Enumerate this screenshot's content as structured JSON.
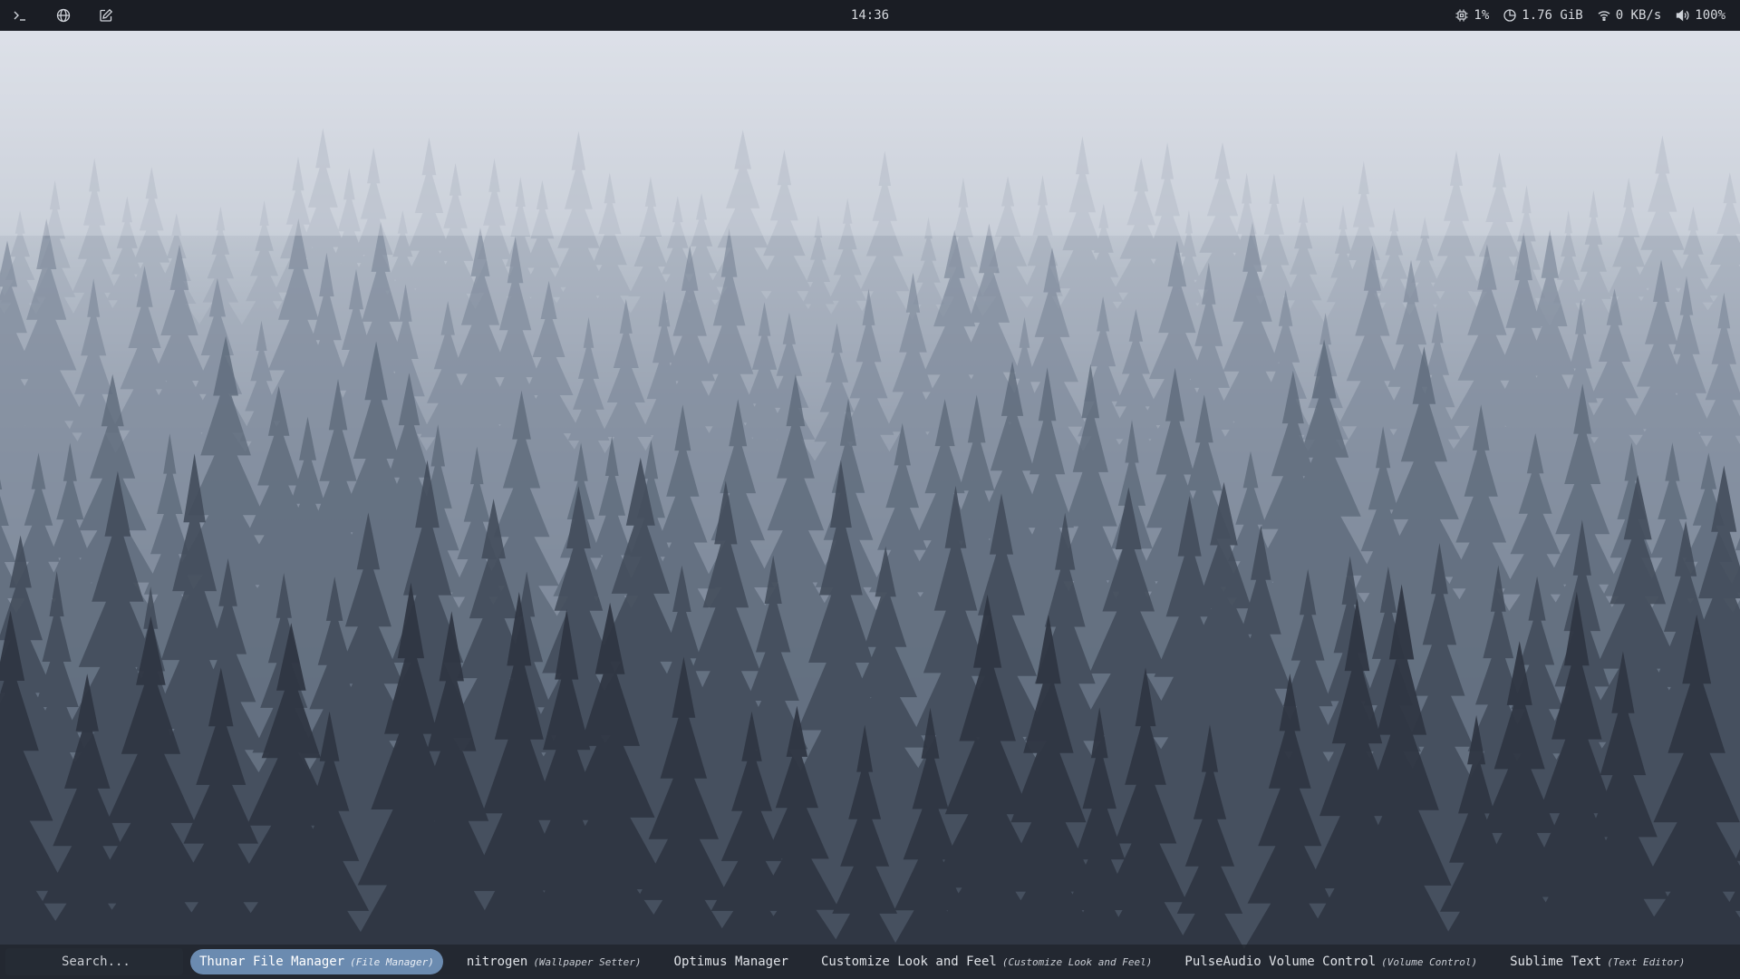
{
  "topbar": {
    "left_icons": [
      "terminal-icon",
      "globe-icon",
      "edit-icon"
    ],
    "clock": "14:36",
    "status": {
      "cpu": "1%",
      "memory": "1.76 GiB",
      "network": "0 KB/s",
      "volume": "100%"
    }
  },
  "launcher": {
    "search_placeholder": "Search...",
    "selected_index": 0,
    "results": [
      {
        "name": "Thunar File Manager",
        "generic": "(File Manager)"
      },
      {
        "name": "nitrogen",
        "generic": "(Wallpaper Setter)"
      },
      {
        "name": "Optimus Manager",
        "generic": ""
      },
      {
        "name": "Customize Look and Feel",
        "generic": "(Customize Look and Feel)"
      },
      {
        "name": "PulseAudio Volume Control",
        "generic": "(Volume Control)"
      },
      {
        "name": "Sublime Text",
        "generic": "(Text Editor)"
      }
    ]
  },
  "colors": {
    "bar_background": "#1a1d24",
    "selection_accent": "#6b8bb0",
    "text": "#dfe2e7"
  }
}
